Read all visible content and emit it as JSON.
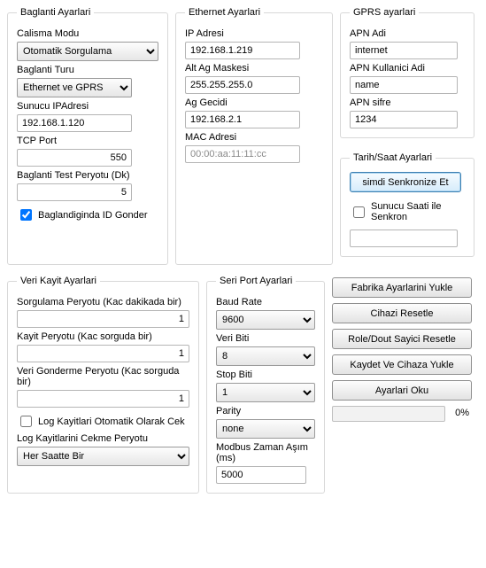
{
  "baglanti": {
    "legend": "Baglanti Ayarlari",
    "calisma_modu_label": "Calisma Modu",
    "calisma_modu_value": "Otomatik Sorgulama",
    "baglanti_turu_label": "Baglanti Turu",
    "baglanti_turu_value": "Ethernet ve GPRS",
    "sunucu_ip_label": "Sunucu IPAdresi",
    "sunucu_ip_value": "192.168.1.120",
    "tcp_port_label": "TCP Port",
    "tcp_port_value": "550",
    "test_peryotu_label": "Baglanti Test Peryotu (Dk)",
    "test_peryotu_value": "5",
    "id_gonder_label": "Baglandiginda ID Gonder"
  },
  "ethernet": {
    "legend": "Ethernet Ayarlari",
    "ip_label": "IP Adresi",
    "ip_value": "192.168.1.219",
    "mask_label": "Alt Ag Maskesi",
    "mask_value": "255.255.255.0",
    "gw_label": "Ag Gecidi",
    "gw_value": "192.168.2.1",
    "mac_label": "MAC Adresi",
    "mac_value": "00:00:aa:11:11:cc"
  },
  "gprs": {
    "legend": "GPRS ayarlari",
    "apn_adi_label": "APN Adi",
    "apn_adi_value": "internet",
    "apn_user_label": "APN Kullanici Adi",
    "apn_user_value": "name",
    "apn_pass_label": "APN sifre",
    "apn_pass_value": "1234"
  },
  "tarih": {
    "legend": "Tarih/Saat Ayarlari",
    "sync_btn": "simdi Senkronize Et",
    "sunucu_saati_label": "Sunucu Saati ile Senkron",
    "extra_value": ""
  },
  "veri": {
    "legend": "Veri Kayit Ayarlari",
    "sorgulama_label": "Sorgulama Peryotu  (Kac dakikada bir)",
    "sorgulama_value": "1",
    "kayit_label": "Kayit Peryotu (Kac sorguda bir)",
    "kayit_value": "1",
    "gonderme_label": "Veri Gonderme Peryotu (Kac sorguda bir)",
    "gonderme_value": "1",
    "log_cek_label": "Log Kayitlari Otomatik Olarak  Cek",
    "log_peryotu_label": "Log Kayitlarini Cekme Peryotu",
    "log_peryotu_value": "Her Saatte Bir"
  },
  "seri": {
    "legend": "Seri Port Ayarlari",
    "baud_label": "Baud Rate",
    "baud_value": "9600",
    "veri_biti_label": "Veri Biti",
    "veri_biti_value": "8",
    "stop_biti_label": "Stop Biti",
    "stop_biti_value": "1",
    "parity_label": "Parity",
    "parity_value": "none",
    "timeout_label": "Modbus Zaman Aşım (ms)",
    "timeout_value": "5000"
  },
  "buttons": {
    "fabrika": "Fabrika Ayarlarini Yukle",
    "reset": "Cihazi Resetle",
    "role_reset": "Role/Dout Sayici Resetle",
    "kaydet": "Kaydet Ve Cihaza Yukle",
    "oku": "Ayarlari Oku",
    "pct": "0%"
  }
}
